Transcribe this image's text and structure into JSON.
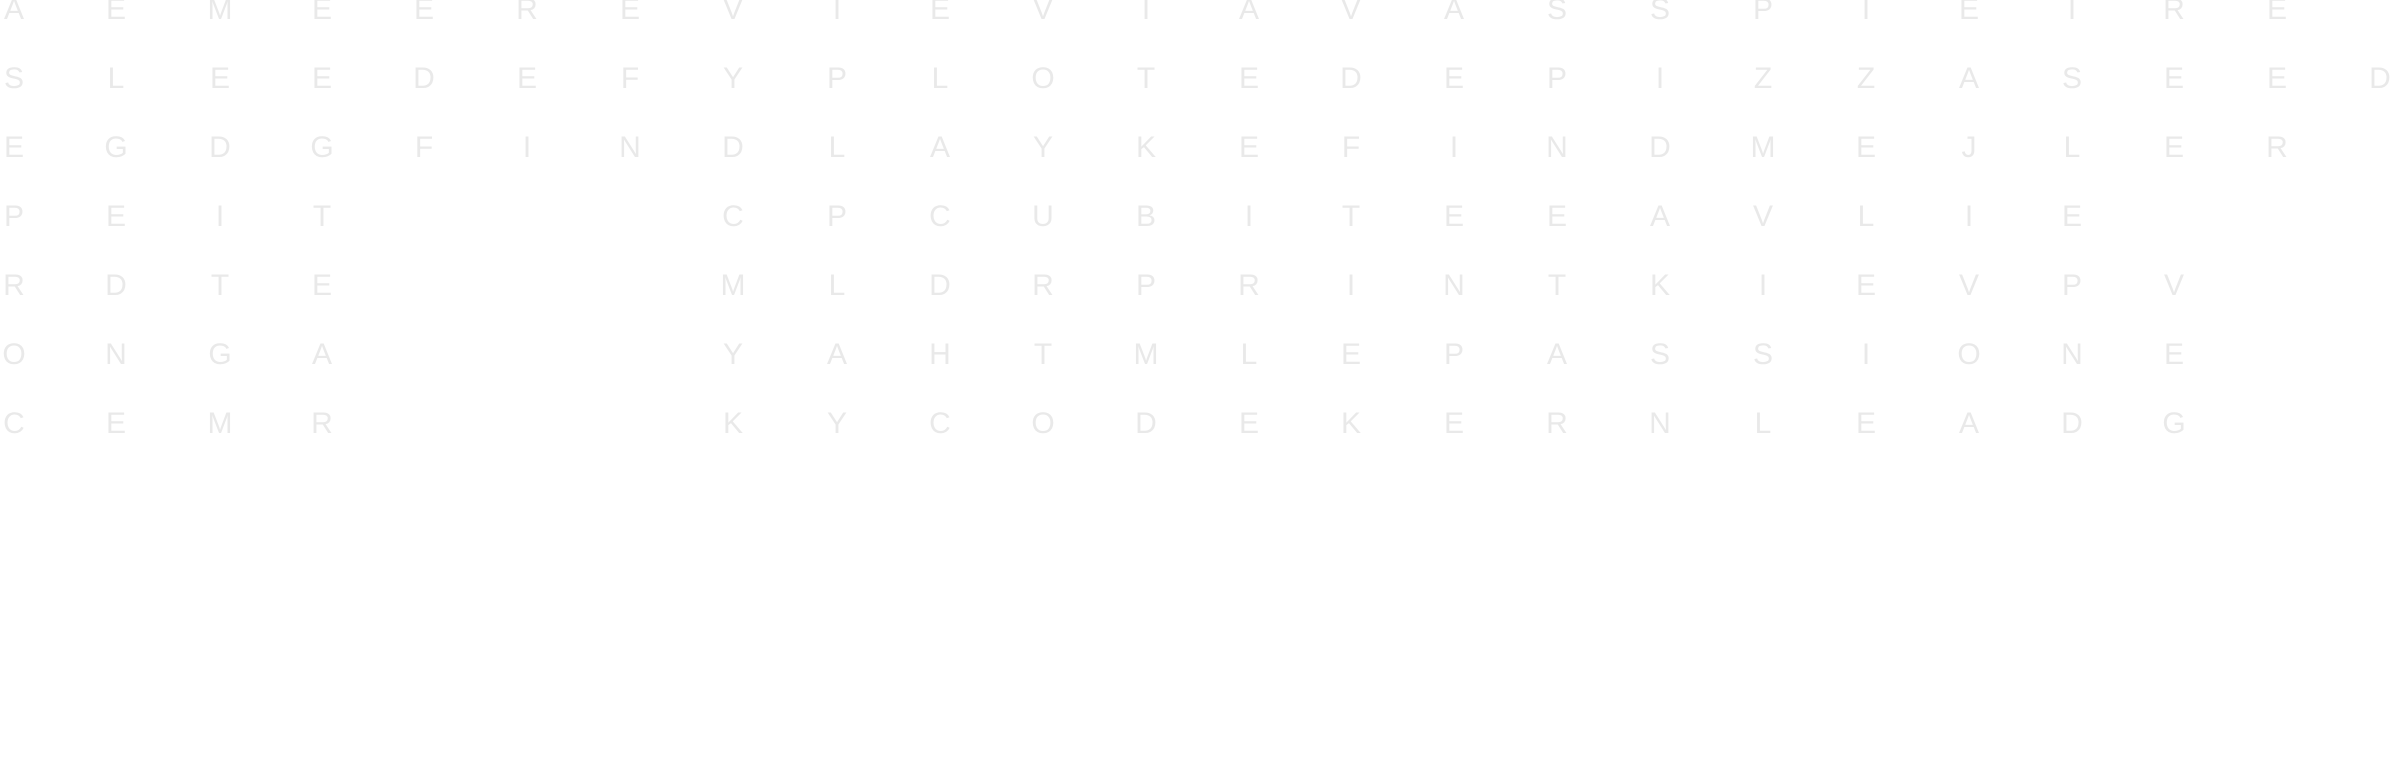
{
  "letters": [
    "AEMEEREVIEVIAVASSPIEIRE",
    "SLEEDEFYPLOTEDEPIZZASEED",
    "EGDGFINDLAYKEFINDMEJLER",
    "PEIT CPCUBITEEAVLIE",
    "RDTE MLDRPRINTKIEVPV",
    "ONGA YAHTMLEPASSIONE",
    "CEMR KYCODEKERNLEADG"
  ]
}
